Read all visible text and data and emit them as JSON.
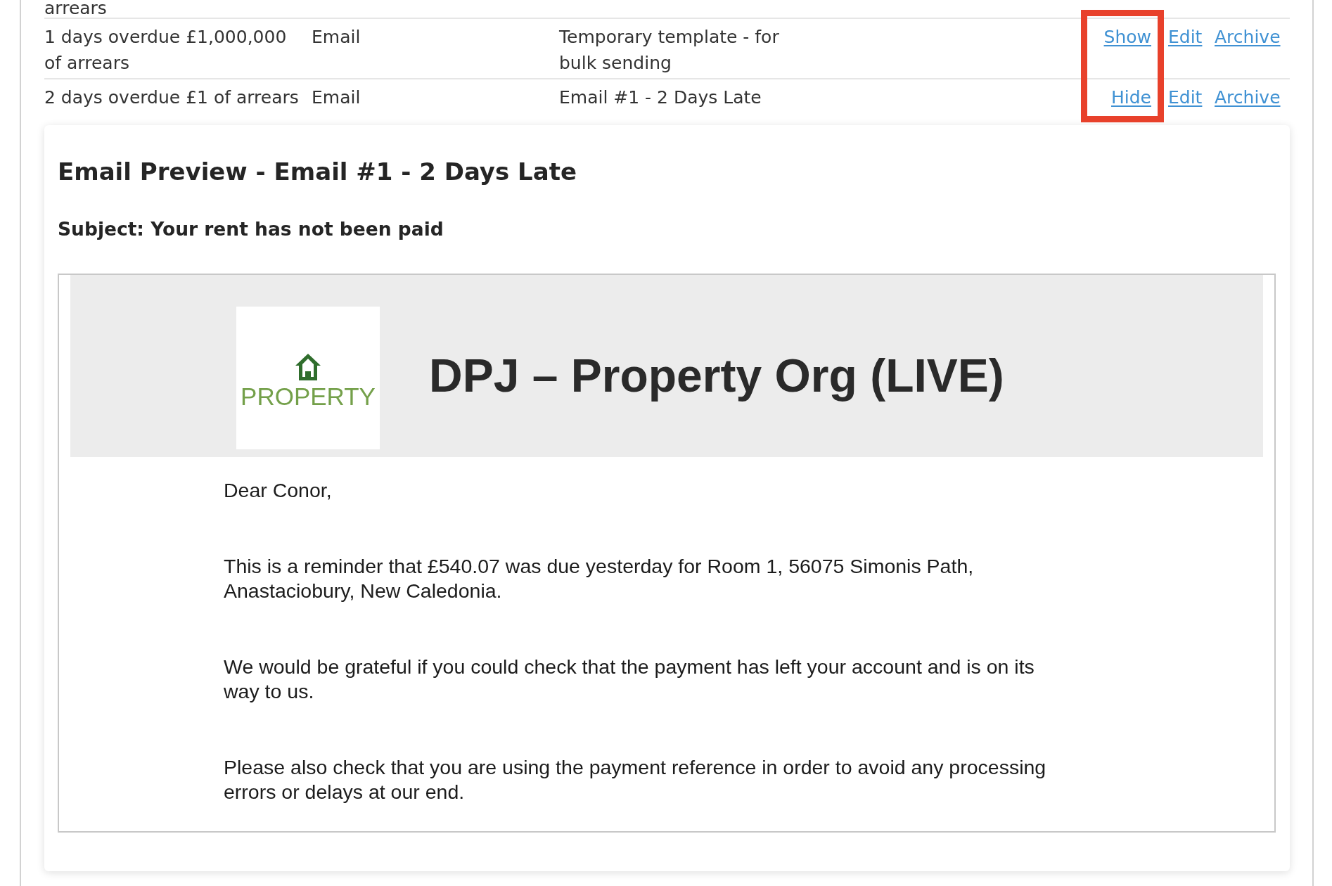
{
  "table": {
    "highlight_toggle_links": true,
    "rows": [
      {
        "column_1": "arrears"
      },
      {
        "column_1": "1 days overdue £1,000,000 of arrears",
        "column_2": "Email",
        "column_3": "Temporary template - for bulk sending",
        "links": [
          {
            "kind": "show",
            "label": "Show"
          },
          {
            "kind": "edit",
            "label": "Edit"
          },
          {
            "kind": "archive",
            "label": "Archive"
          }
        ]
      },
      {
        "column_1": "2 days overdue £1 of arrears",
        "column_2": "Email",
        "column_3": "Email #1 - 2 Days Late",
        "links": [
          {
            "kind": "hide",
            "label": "Hide"
          },
          {
            "kind": "edit",
            "label": "Edit"
          },
          {
            "kind": "archive",
            "label": "Archive"
          }
        ]
      }
    ]
  },
  "preview": {
    "title": "Email Preview - Email #1 - 2 Days Late",
    "subject": "Subject: Your rent has not been paid",
    "email": {
      "logo_text": "PROPERTY",
      "org_name": "DPJ – Property Org (LIVE)",
      "paragraphs": [
        "Dear Conor,",
        "This is a reminder that £540.07 was due yesterday for Room 1, 56075 Simonis Path, Anastaciobury, New Caledonia.",
        "We would be grateful if you could check that the payment has left your account and is on its way to us.",
        "Please also check that you are using the payment reference in order to avoid any processing errors or delays at our end."
      ]
    }
  }
}
